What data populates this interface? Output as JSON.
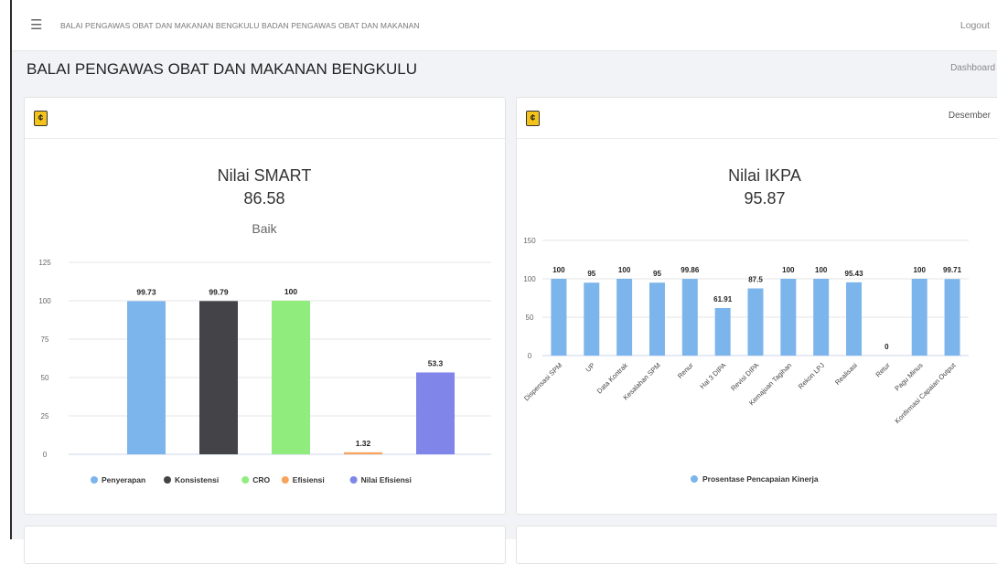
{
  "topbar": {
    "menu_icon": "hamburger-icon",
    "title": "BALAI PENGAWAS OBAT DAN MAKANAN BENGKULU BADAN PENGAWAS OBAT DAN MAKANAN",
    "logout": "Logout"
  },
  "page": {
    "title": "BALAI PENGAWAS OBAT DAN MAKANAN BENGKULU",
    "breadcrumb": "Dashboard"
  },
  "cards": {
    "smart": {
      "icon": "coin-icon",
      "header_right": ""
    },
    "ikpa": {
      "icon": "coin-icon",
      "header_right": "Desember"
    }
  },
  "chart_data": [
    {
      "type": "bar",
      "title": "Nilai SMART",
      "subtitle": "86.58",
      "subtitle2": "Baik",
      "categories": [
        "Penyerapan",
        "Konsistensi",
        "CRO",
        "Efisiensi",
        "Nilai Efisiensi"
      ],
      "values": [
        99.73,
        99.79,
        100,
        1.32,
        53.3
      ],
      "data_labels": [
        "99.73",
        "99.79",
        "100",
        "1.32",
        "53.3"
      ],
      "colors": [
        "#7cb5ec",
        "#434348",
        "#90ed7d",
        "#f7a35c",
        "#8085e9"
      ],
      "yticks": [
        "0",
        "25",
        "50",
        "75",
        "100",
        "125"
      ],
      "ylim": [
        0,
        125
      ],
      "legend": "bottom",
      "legend_entries": [
        "Penyerapan",
        "Konsistensi",
        "CRO",
        "Efisiensi",
        "Nilai Efisiensi"
      ],
      "grid": true
    },
    {
      "type": "bar",
      "title": "Nilai IKPA",
      "subtitle": "95.87",
      "categories": [
        "Dispensasi SPM",
        "UP",
        "Data Kontrak",
        "Kesalahan SPM",
        "Renur",
        "Hal 3 DIPA",
        "Revisi DIPA",
        "Kemajuan Tagihan",
        "Rekon LPJ",
        "Realisasi",
        "Retur",
        "Pagu Minus",
        "Konfirmasi Capaian Output"
      ],
      "values": [
        100,
        95,
        100,
        95,
        99.86,
        61.91,
        87.5,
        100,
        100,
        95.43,
        0,
        100,
        99.71
      ],
      "data_labels": [
        "100",
        "95",
        "100",
        "95",
        "99.86",
        "61.91",
        "87.5",
        "100",
        "100",
        "95.43",
        "0",
        "100",
        "99.71"
      ],
      "color": "#7cb5ec",
      "yticks": [
        "0",
        "50",
        "100",
        "150"
      ],
      "ylim": [
        0,
        150
      ],
      "legend": "bottom",
      "legend_entries": [
        "Prosentase Pencapaian Kinerja"
      ],
      "grid": true
    }
  ]
}
